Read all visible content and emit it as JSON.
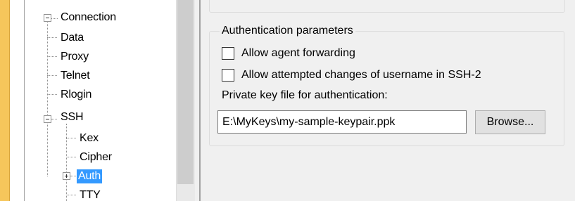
{
  "tree": {
    "items": [
      {
        "label": "Connection",
        "level": 0,
        "expander": "minus"
      },
      {
        "label": "Data",
        "level": 1
      },
      {
        "label": "Proxy",
        "level": 1
      },
      {
        "label": "Telnet",
        "level": 1
      },
      {
        "label": "Rlogin",
        "level": 1
      },
      {
        "label": "SSH",
        "level": 1,
        "expander": "minus"
      },
      {
        "label": "Kex",
        "level": 2
      },
      {
        "label": "Cipher",
        "level": 2
      },
      {
        "label": "Auth",
        "level": 2,
        "expander": "plus",
        "selected": true
      },
      {
        "label": "TTY",
        "level": 2
      }
    ]
  },
  "auth": {
    "group_title": "Authentication parameters",
    "allow_agent_forwarding": {
      "label": "Allow agent forwarding",
      "checked": false
    },
    "allow_username_changes": {
      "label": "Allow attempted changes of username in SSH-2",
      "checked": false
    },
    "private_key_label": "Private key file for authentication:",
    "private_key_value": "E:\\MyKeys\\my-sample-keypair.ppk",
    "browse_label": "Browse..."
  },
  "colors": {
    "selection": "#3399ff",
    "accent_strip": "#f6c65b"
  }
}
